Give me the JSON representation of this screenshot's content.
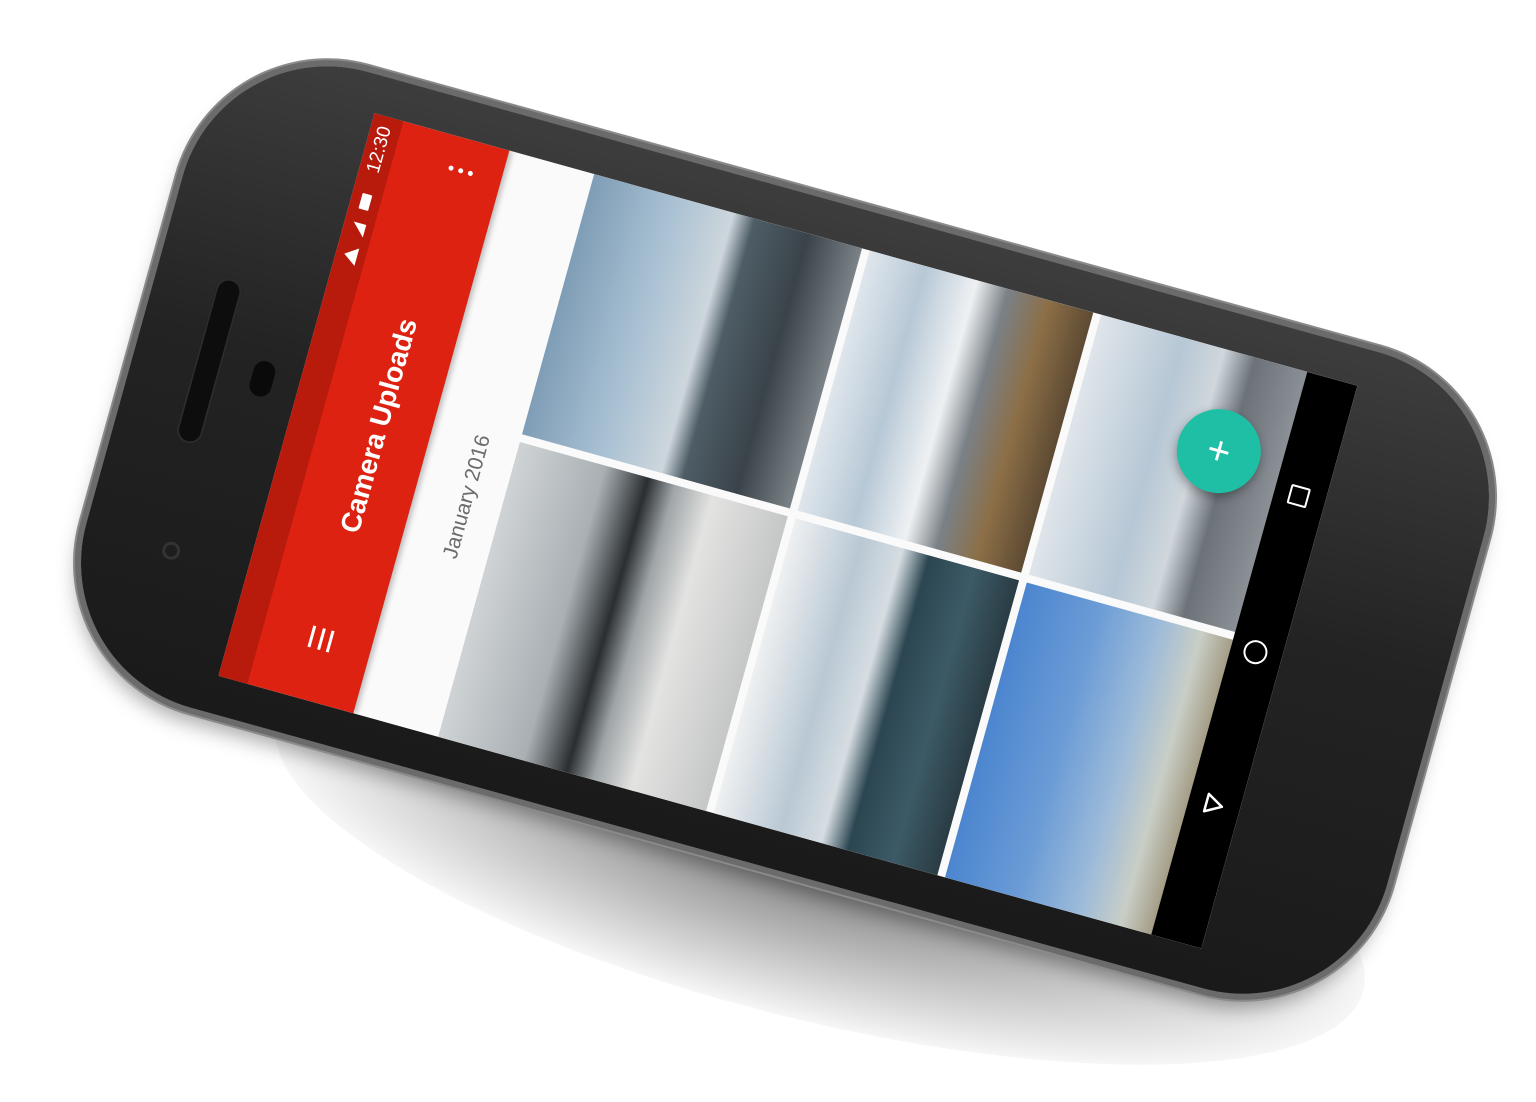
{
  "status_bar": {
    "time": "12:30"
  },
  "app_bar": {
    "title": "Camera Uploads",
    "menu_icon": "hamburger-menu-icon",
    "overflow_icon": "more-vert-icon",
    "color": "#dd2211"
  },
  "content": {
    "section_label": "January 2016",
    "photos": [
      {
        "subject": "lake-shore"
      },
      {
        "subject": "mountain-reflection"
      },
      {
        "subject": "clouds-grass"
      },
      {
        "subject": "clouds-lake"
      },
      {
        "subject": "mist-trees"
      },
      {
        "subject": "blue-sky-mountains"
      }
    ]
  },
  "fab": {
    "label": "+",
    "icon": "add-icon",
    "color": "#1fbfa6"
  },
  "nav_bar": {
    "buttons": [
      "recents-icon",
      "home-icon",
      "back-icon"
    ]
  }
}
